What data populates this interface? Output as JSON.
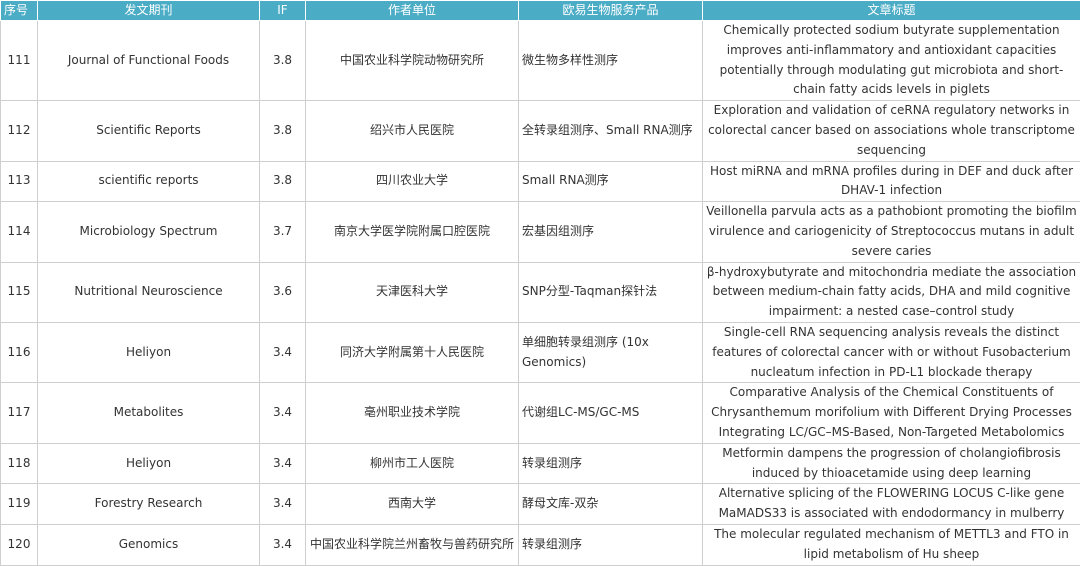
{
  "table": {
    "headers": [
      "序号",
      "发文期刊",
      "IF",
      "作者单位",
      "欧易生物服务产品",
      "文章标题"
    ],
    "rows": [
      {
        "no": "111",
        "journal": "Journal of Functional Foods",
        "if": "3.8",
        "unit": "中国农业科学院动物研究所",
        "service": "微生物多样性测序",
        "title": "Chemically protected sodium butyrate supplementation improves anti-inflammatory and antioxidant capacities potentially through modulating gut microbiota and short-chain fatty acids levels in piglets"
      },
      {
        "no": "112",
        "journal": "Scientific Reports",
        "if": "3.8",
        "unit": "绍兴市人民医院",
        "service": "全转录组测序、Small RNA测序",
        "title": "Exploration and validation of ceRNA regulatory networks in colorectal cancer based on associations whole transcriptome sequencing"
      },
      {
        "no": "113",
        "journal": "scientific reports",
        "if": "3.8",
        "unit": "四川农业大学",
        "service": "Small RNA测序",
        "title": "Host miRNA and mRNA profiles during in DEF and duck after DHAV-1 infection"
      },
      {
        "no": "114",
        "journal": "Microbiology Spectrum",
        "if": "3.7",
        "unit": "南京大学医学院附属口腔医院",
        "service": "宏基因组测序",
        "title": "Veillonella parvula acts as a pathobiont promoting the biofilm virulence and cariogenicity of Streptococcus mutans in adult severe caries"
      },
      {
        "no": "115",
        "journal": "Nutritional Neuroscience",
        "if": "3.6",
        "unit": "天津医科大学",
        "service": "SNP分型-Taqman探针法",
        "title": "β-hydroxybutyrate and mitochondria mediate the association between medium-chain fatty acids, DHA and mild cognitive impairment: a nested case–control study"
      },
      {
        "no": "116",
        "journal": "Heliyon",
        "if": "3.4",
        "unit": "同济大学附属第十人民医院",
        "service": "单细胞转录组测序 (10x Genomics)",
        "title": "Single-cell RNA sequencing analysis reveals the distinct features of colorectal cancer with or without Fusobacterium nucleatum infection in PD-L1 blockade therapy"
      },
      {
        "no": "117",
        "journal": "Metabolites",
        "if": "3.4",
        "unit": "亳州职业技术学院",
        "service": "代谢组LC-MS/GC-MS",
        "title": "Comparative Analysis of the Chemical Constituents of Chrysanthemum morifolium with Different Drying Processes Integrating LC/GC–MS-Based, Non-Targeted Metabolomics"
      },
      {
        "no": "118",
        "journal": "Heliyon",
        "if": "3.4",
        "unit": "柳州市工人医院",
        "service": "转录组测序",
        "title": "Metformin dampens the progression of cholangiofibrosis induced by thioacetamide using deep learning"
      },
      {
        "no": "119",
        "journal": "Forestry Research",
        "if": "3.4",
        "unit": "西南大学",
        "service": "酵母文库-双杂",
        "title": "Alternative splicing of the FLOWERING LOCUS C-like gene MaMADS33 is associated with endodormancy in mulberry"
      },
      {
        "no": "120",
        "journal": "Genomics",
        "if": "3.4",
        "unit": "中国农业科学院兰州畜牧与兽药研究所",
        "service": "转录组测序",
        "title": "The molecular regulated mechanism of METTL3 and FTO in lipid metabolism of Hu sheep"
      }
    ]
  }
}
